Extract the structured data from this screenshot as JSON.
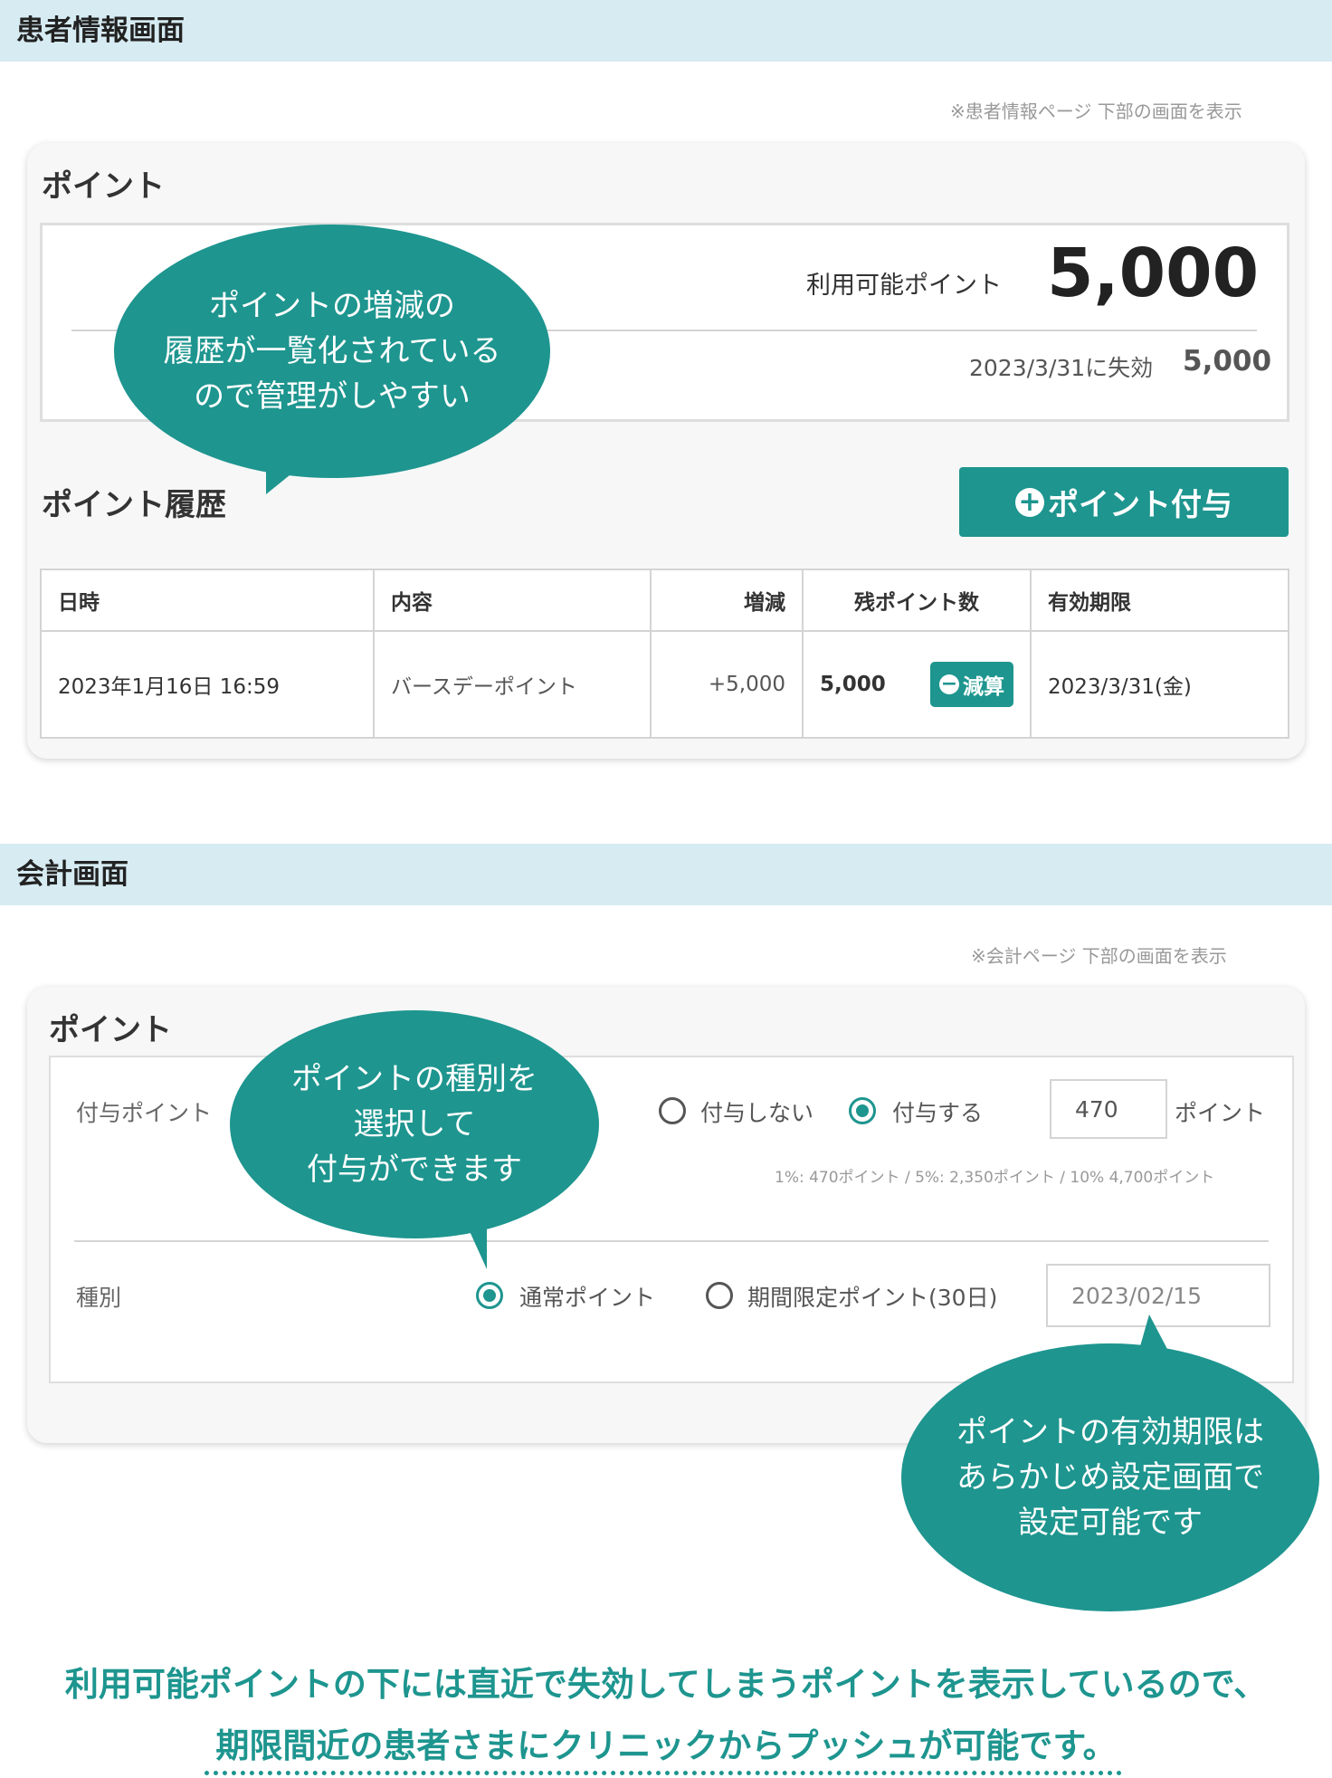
{
  "patient_section": {
    "title": "患者情報画面",
    "note": "※患者情報ページ 下部の画面を表示",
    "card_title": "ポイント",
    "available_label": "利用可能ポイント",
    "available_value": "5,000",
    "expiry_label": "2023/3/31に失効",
    "expiry_value": "5,000",
    "bubble": "ポイントの増減の\n履歴が一覧化されている\nので管理がしやすい",
    "history_title": "ポイント履歴",
    "add_button_label": "ポイント付与",
    "table": {
      "headers": [
        "日時",
        "内容",
        "増減",
        "残ポイント数",
        "有効期限"
      ],
      "rows": [
        {
          "datetime": "2023年1月16日 16:59",
          "content": "バースデーポイント",
          "change": "+5,000",
          "balance": "5,000",
          "reduce_label": "減算",
          "expiry": "2023/3/31(金)"
        }
      ]
    }
  },
  "accounting_section": {
    "title": "会計画面",
    "note": "※会計ページ 下部の画面を表示",
    "card_title": "ポイント",
    "grant_label": "付与ポイント",
    "grant_options": [
      "付与しない",
      "付与する"
    ],
    "grant_selected": "付与する",
    "points_value": "470",
    "points_unit": "ポイント",
    "hint": "1%: 470ポイント / 5%: 2,350ポイント / 10% 4,700ポイント",
    "type_label": "種別",
    "type_options": [
      "通常ポイント",
      "期間限定ポイント(30日)"
    ],
    "type_selected": "通常ポイント",
    "date_value": "2023/02/15",
    "bubble_type": "ポイントの種別を\n選択して\n付与ができます",
    "bubble_expiry": "ポイントの有効期限は\nあらかじめ設定画面で\n設定可能です"
  },
  "footer": {
    "line1": "利用可能ポイントの下には直近で失効してしまうポイントを表示しているので、",
    "line2": "期限間近の患者さまにクリニックからプッシュが可能です。"
  },
  "colors": {
    "accent": "#1e958f",
    "section_bar": "#d6ebf2",
    "card_bg": "#f7f7f7"
  }
}
